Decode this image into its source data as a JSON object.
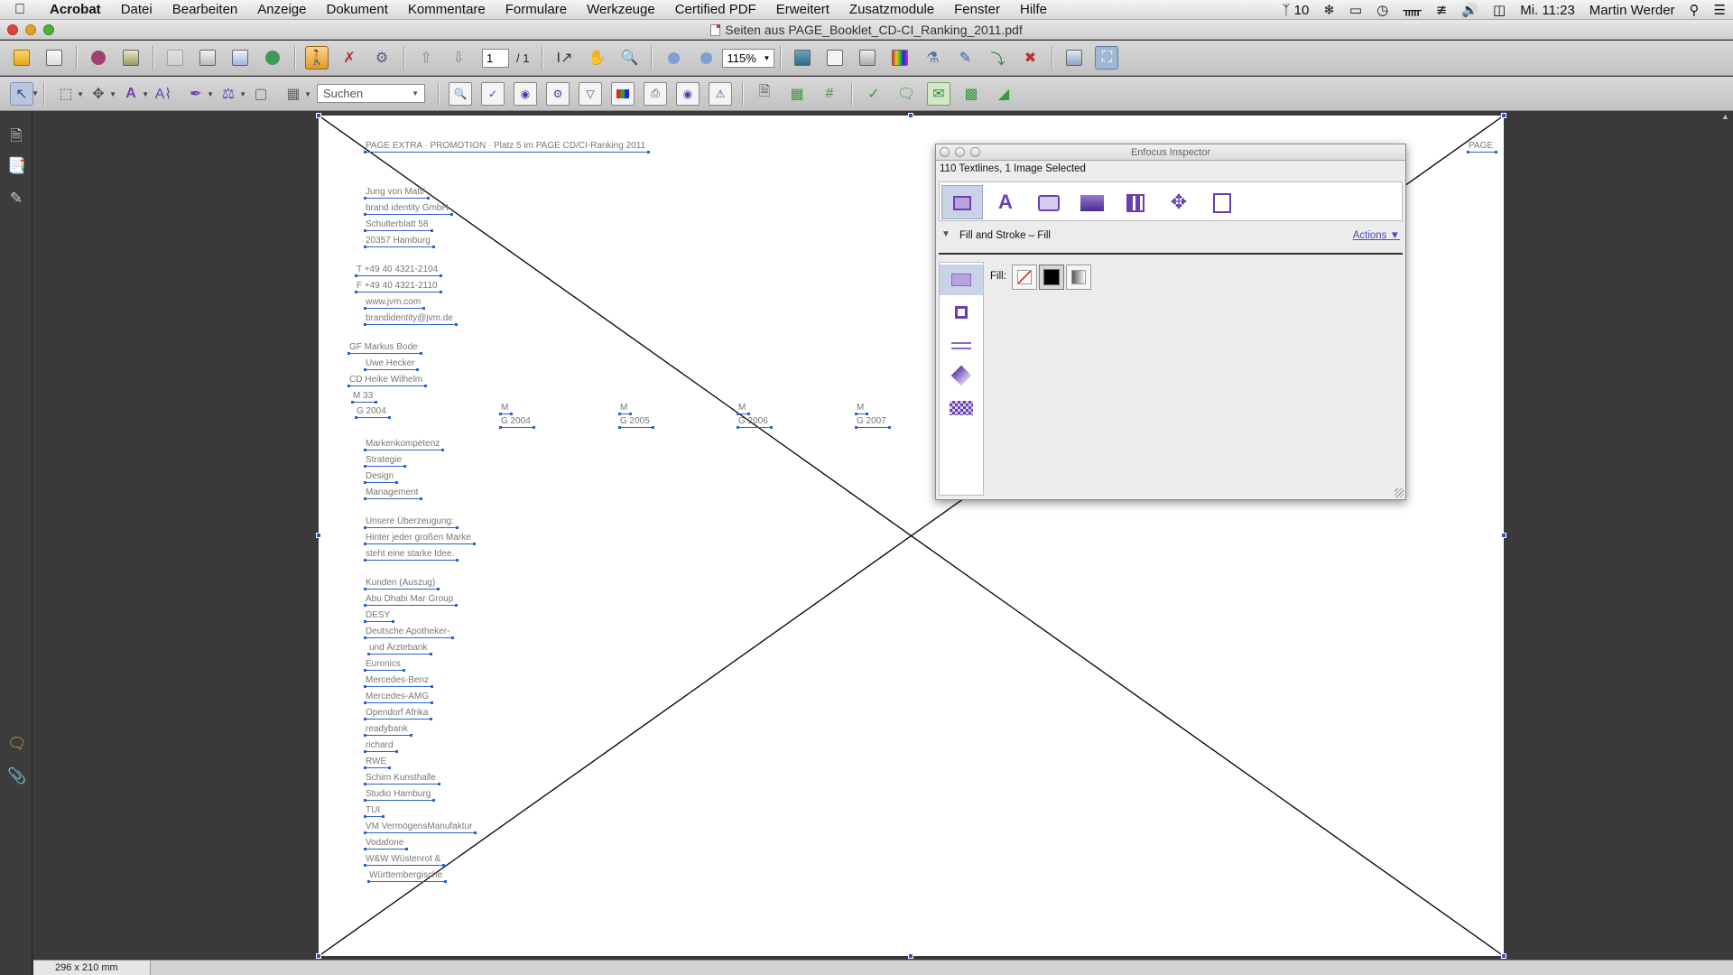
{
  "menubar": {
    "apple": "",
    "items": [
      "Acrobat",
      "Datei",
      "Bearbeiten",
      "Anzeige",
      "Dokument",
      "Kommentare",
      "Formulare",
      "Werkzeuge",
      "Certified PDF",
      "Erweitert",
      "Zusatzmodule",
      "Fenster",
      "Hilfe"
    ],
    "status": {
      "adobe_count": "10",
      "clock": "Mi. 11:23",
      "user": "Martin Werder"
    }
  },
  "window": {
    "title": "Seiten aus PAGE_Booklet_CD-CI_Ranking_2011.pdf"
  },
  "toolbar": {
    "page_current": "1",
    "page_total": "/ 1",
    "zoom": "115%",
    "search_placeholder": "Suchen"
  },
  "statusbar": {
    "page_size": "296 x 210 mm"
  },
  "page_text": {
    "header": "PAGE EXTRA · PROMOTION · Platz 5 im PAGE CD/CI-Ranking 2011",
    "address": [
      "Jung von Matt/",
      "brand identity GmbH",
      "Schulterblatt 58",
      "20357 Hamburg"
    ],
    "contact": [
      "T +49 40 4321-2104",
      "F +49 40 4321-2110",
      "www.jvm.com",
      "brandidentity@jvm.de"
    ],
    "people": [
      "GF Markus Bode",
      "Uwe Hecker",
      "CD Heike Wilhelm",
      "M 33",
      "G 2004"
    ],
    "years": [
      {
        "m": "M",
        "y": "G 2004"
      },
      {
        "m": "M",
        "y": "G 2005"
      },
      {
        "m": "M",
        "y": "G 2006"
      },
      {
        "m": "M",
        "y": "G 2007"
      }
    ],
    "competence": [
      "Markenkompetenz",
      "Strategie",
      "Design",
      "Management"
    ],
    "conviction": [
      "Unsere Überzeugung:",
      "Hinter jeder großen Marke",
      "steht eine starke Idee."
    ],
    "clients": [
      "Kunden (Auszug)",
      "Abu Dhabi Mar Group",
      "DESY",
      "Deutsche Apotheker-",
      "und Ärztebank",
      "Euronics",
      "Mercedes-Benz",
      "Mercedes-AMG",
      "Opendorf Afrika",
      "readybank",
      "richard",
      "RWE",
      "Schirn Kunsthalle",
      "Studio Hamburg",
      "TUI",
      "VM VermögensManufaktur",
      "Vodafone",
      "W&W Wüstenrot &",
      "Württembergische"
    ],
    "corner": "PAGE"
  },
  "inspector": {
    "title": "Enfocus Inspector",
    "selection": "110 Textlines, 1 Image Selected",
    "tabs": [
      "object-icon",
      "text-icon",
      "image-icon",
      "monitor-icon",
      "grid-icon",
      "position-icon",
      "document-icon"
    ],
    "section_title": "Fill and Stroke – Fill",
    "actions": "Actions",
    "fill_label": "Fill:",
    "subtabs": [
      "fill-icon",
      "stroke-icon",
      "dash-icon",
      "blend-icon",
      "transparency-icon"
    ],
    "swatches": [
      "none-swatch",
      "solid-swatch",
      "gradient-swatch"
    ],
    "accent_color": "#6a3fb0"
  }
}
